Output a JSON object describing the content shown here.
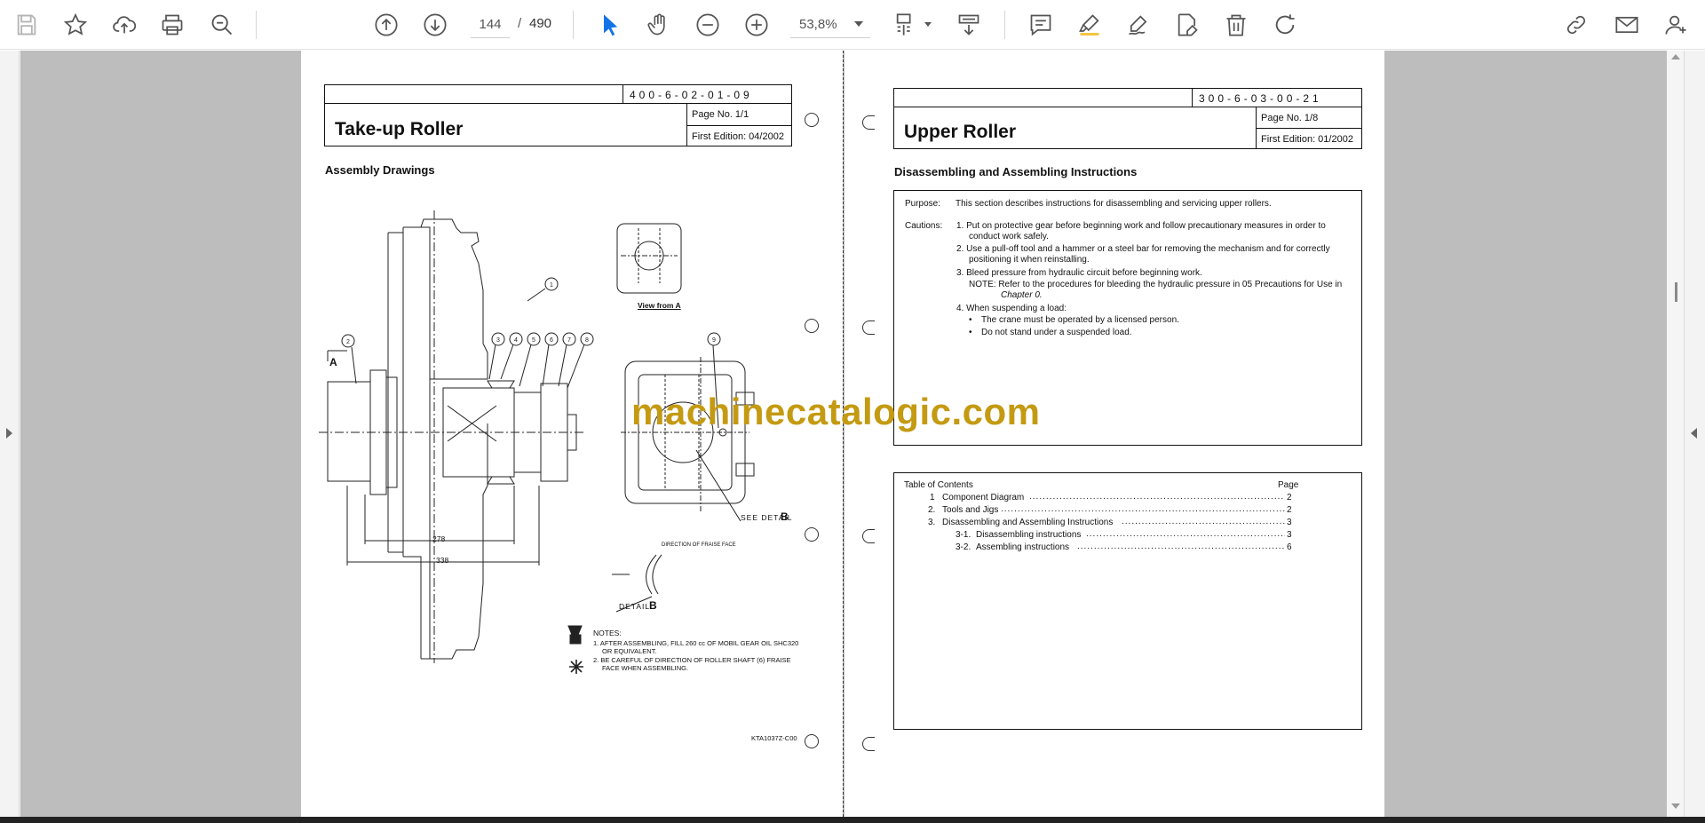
{
  "toolbar": {
    "page_current": "144",
    "page_separator": "/",
    "page_total": "490",
    "zoom": "53,8%"
  },
  "left_page": {
    "doc_number": "400-6-02-01-09",
    "title": "Take-up Roller",
    "page_no": "Page No. 1/1",
    "first_edition": "First Edition: 04/2002",
    "section": "Assembly Drawings",
    "view_label": "View from A",
    "see_detail": "SEE DETAIL",
    "detail_letter": "B",
    "detail_label": "DETAIL",
    "label_a": "A",
    "direction_note": "DIRECTION OF FRAISE FACE",
    "dim_1": "278",
    "dim_2": "338",
    "notes_header": "NOTES:",
    "note_1": "1. AFTER ASSEMBLING, FILL 260 cc OF MOBIL GEAR OIL SHC320",
    "note_1b": "OR EQUIVALENT.",
    "note_2": "2. BE CAREFUL OF DIRECTION OF ROLLER SHAFT (6) FRAISE",
    "note_2b": "FACE WHEN ASSEMBLING.",
    "part_code": "KTA1037Z-C00",
    "balloons": [
      "1",
      "2",
      "3",
      "4",
      "5",
      "6",
      "7",
      "8",
      "9"
    ]
  },
  "right_page": {
    "doc_number": "300-6-03-00-21",
    "title": "Upper Roller",
    "page_no": "Page No. 1/8",
    "first_edition": "First Edition: 01/2002",
    "section": "Disassembling and Assembling Instructions",
    "purpose_label": "Purpose:",
    "purpose_text": "This section describes instructions for disassembling and servicing upper rollers.",
    "cautions_label": "Cautions:",
    "caution_1a": "1.  Put on protective gear before beginning work and follow precautionary measures in order to",
    "caution_1b": "conduct work safely.",
    "caution_2a": "2.  Use a pull-off tool and a hammer or a steel bar for removing the mechanism and for correctly",
    "caution_2b": "positioning it when reinstalling.",
    "caution_3": "3.  Bleed pressure from hydraulic circuit before beginning work.",
    "note_a": "NOTE:  Refer to the procedures for bleeding the hydraulic pressure in 05 Precautions for Use in",
    "note_b": "Chapter 0.",
    "caution_4": "4.  When suspending a load:",
    "bullet_1": "The crane must be operated by a licensed person.",
    "bullet_2": "Do not stand under a suspended load.",
    "toc_title": "Table of Contents",
    "toc_page_header": "Page",
    "toc": [
      {
        "num": "1",
        "title": "Component Diagram",
        "page": "2"
      },
      {
        "num": "2.",
        "title": "Tools and Jigs",
        "page": "2"
      },
      {
        "num": "3.",
        "title": "Disassembling and Assembling Instructions",
        "page": "3"
      },
      {
        "num": "3-1.",
        "title": "Disassembling instructions",
        "page": "3"
      },
      {
        "num": "3-2.",
        "title": "Assembling instructions",
        "page": "6"
      }
    ]
  },
  "watermark": "machinecatalogic.com"
}
